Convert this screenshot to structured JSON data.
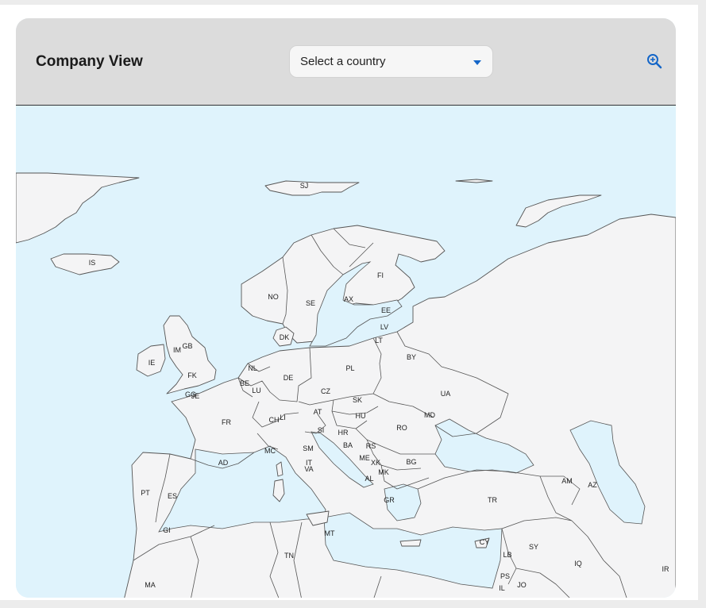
{
  "header": {
    "title": "Company View",
    "select_placeholder": "Select a country"
  },
  "icons": {
    "zoom": "zoom-in-icon",
    "caret": "chevron-down-icon"
  },
  "colors": {
    "sea": "#dff3fc",
    "land": "#f4f4f5",
    "header": "#dcdcdc",
    "accent": "#1466c8"
  },
  "map": {
    "country_labels": [
      "SJ",
      "IS",
      "FI",
      "NO",
      "SE",
      "AX",
      "EE",
      "LV",
      "LT",
      "DK",
      "IE",
      "IM",
      "GB",
      "BY",
      "PL",
      "NL",
      "DE",
      "BE",
      "LU",
      "FK",
      "GG",
      "JE",
      "CZ",
      "UA",
      "SK",
      "FR",
      "AT",
      "LI",
      "CH",
      "HU",
      "MD",
      "SI",
      "HR",
      "RO",
      "SM",
      "BA",
      "RS",
      "MC",
      "ME",
      "XK",
      "AD",
      "IT",
      "VA",
      "BG",
      "MK",
      "AL",
      "PT",
      "ES",
      "AM",
      "AZ",
      "GR",
      "TR",
      "GI",
      "MT",
      "CY",
      "LB",
      "SY",
      "TN",
      "IQ",
      "PS",
      "IR",
      "MA",
      "JO",
      "IL"
    ]
  }
}
